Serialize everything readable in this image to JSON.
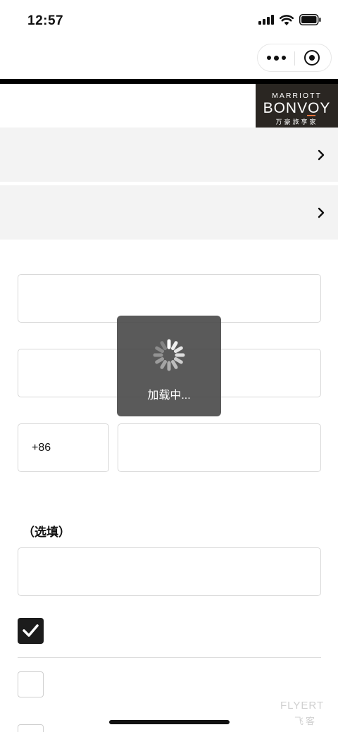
{
  "status_bar": {
    "time": "12:57",
    "icons": [
      "signal-icon",
      "wifi-icon",
      "battery-icon"
    ]
  },
  "capsule": {
    "icons": [
      "more-dots-icon",
      "close-target-icon"
    ]
  },
  "brand": {
    "line1": "MARRIOTT",
    "line2": "BONVOY",
    "line3": "万豪旅享家",
    "accent_color": "#e3703a",
    "bg_color": "#2a2622"
  },
  "form": {
    "phone_code": "+86",
    "optional_label": "（选填）",
    "checkboxes": [
      {
        "checked": true
      },
      {
        "checked": false
      },
      {
        "checked": false
      }
    ]
  },
  "toast": {
    "text": "加载中..."
  },
  "watermark": {
    "line1": "FLYERT",
    "line2": "飞客"
  }
}
